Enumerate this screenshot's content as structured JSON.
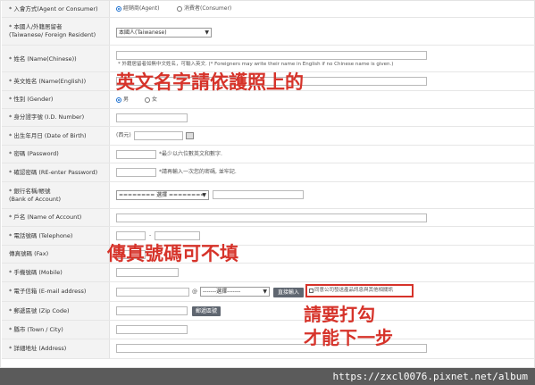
{
  "form": {
    "identity": {
      "label": "* 入會方式(Agent or Consumer)",
      "opt1": "經銷商(Agent)",
      "opt2": "消費者(Consumer)"
    },
    "nationality": {
      "label1": "* 本國人/外籍居留者",
      "label2": "(Taiwanese/ Foreign Resident)",
      "value": "本國人(Taiwanese)"
    },
    "name": {
      "label": "* 姓名 (Name(Chinese))",
      "hint": "* 外籍居留者如無中文姓名，可輸入英文. (* Foreigners may write their name in English if no Chinese name is given.)"
    },
    "ename": {
      "label": "* 英文姓名 (Name(English))"
    },
    "gender": {
      "label": "* 性別 (Gender)",
      "male": "男",
      "female": "女"
    },
    "id": {
      "label": "* 身分證字號 (I.D. Number)"
    },
    "dob": {
      "label": "* 出生年月日 (Date of Birth)",
      "prefix": "(西元)"
    },
    "pwd": {
      "label": "* 密碼 (Password)",
      "hint": "*最少以六位數英文和數字."
    },
    "repwd": {
      "label": "* 確認密碼 (RE-enter Password)",
      "hint": "*請再輸入一次您的密碼, 並牢記."
    },
    "bank": {
      "label1": "* 銀行名稱/帳號",
      "label2": "(Bank of Account)",
      "select": "======== 選擇 ========"
    },
    "account_name": {
      "label": "* 戶名 (Name of Account)"
    },
    "tel": {
      "label": "* 電話號碼 (Telephone)",
      "sep": "-"
    },
    "fax": {
      "label": "傳真號碼 (Fax)"
    },
    "mobile": {
      "label": "* 手機號碼 (Mobile)"
    },
    "email": {
      "label": "* 電子信箱 (E-mail address)",
      "at": "@",
      "select": "-------選擇-------",
      "btn": "直接輸入",
      "agree": "同意公司發送產品訊息與其他相關訊"
    },
    "zip": {
      "label": "* 郵遞區號 (Zip Code)",
      "btn": "郵遞區號"
    },
    "town": {
      "label": "* 縣市 (Town / City)"
    },
    "address": {
      "label": "* 詳細地址 (Address)"
    }
  },
  "annotations": {
    "ename": "英文名字請依護照上的",
    "fax": "傳真號碼可不填",
    "check1": "請要打勾",
    "check2": "才能下一步"
  },
  "footer": {
    "url": "https://zxcl0076.pixnet.net/album"
  }
}
